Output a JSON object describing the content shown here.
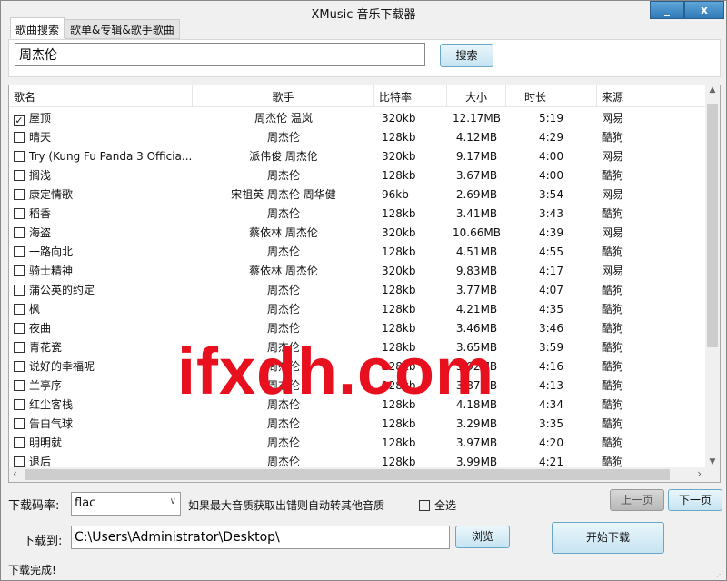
{
  "window": {
    "title": "XMusic 音乐下载器",
    "minimize": "_",
    "close": "x"
  },
  "tabs": [
    {
      "label": "歌曲搜索",
      "active": true
    },
    {
      "label": "歌单&专辑&歌手歌曲",
      "active": false
    }
  ],
  "search": {
    "value": "周杰伦",
    "button": "搜索"
  },
  "table": {
    "columns": [
      "歌名",
      "歌手",
      "比特率",
      "大小",
      "时长",
      "来源"
    ],
    "rows": [
      {
        "checked": true,
        "name": "屋顶",
        "singer": "周杰伦 温岚",
        "bitrate": "320kb",
        "size": "12.17MB",
        "duration": "5:19",
        "source": "网易"
      },
      {
        "checked": false,
        "name": "晴天",
        "singer": "周杰伦",
        "bitrate": "128kb",
        "size": "4.12MB",
        "duration": "4:29",
        "source": "酷狗"
      },
      {
        "checked": false,
        "name": "Try (Kung Fu Panda 3 Officia...",
        "singer": "派伟俊 周杰伦",
        "bitrate": "320kb",
        "size": "9.17MB",
        "duration": "4:00",
        "source": "网易"
      },
      {
        "checked": false,
        "name": "搁浅",
        "singer": "周杰伦",
        "bitrate": "128kb",
        "size": "3.67MB",
        "duration": "4:00",
        "source": "酷狗"
      },
      {
        "checked": false,
        "name": "康定情歌",
        "singer": "宋祖英 周杰伦 周华健",
        "bitrate": "96kb",
        "size": "2.69MB",
        "duration": "3:54",
        "source": "网易"
      },
      {
        "checked": false,
        "name": "稻香",
        "singer": "周杰伦",
        "bitrate": "128kb",
        "size": "3.41MB",
        "duration": "3:43",
        "source": "酷狗"
      },
      {
        "checked": false,
        "name": "海盗",
        "singer": "蔡依林 周杰伦",
        "bitrate": "320kb",
        "size": "10.66MB",
        "duration": "4:39",
        "source": "网易"
      },
      {
        "checked": false,
        "name": "一路向北",
        "singer": "周杰伦",
        "bitrate": "128kb",
        "size": "4.51MB",
        "duration": "4:55",
        "source": "酷狗"
      },
      {
        "checked": false,
        "name": "骑士精神",
        "singer": "蔡依林 周杰伦",
        "bitrate": "320kb",
        "size": "9.83MB",
        "duration": "4:17",
        "source": "网易"
      },
      {
        "checked": false,
        "name": "蒲公英的约定",
        "singer": "周杰伦",
        "bitrate": "128kb",
        "size": "3.77MB",
        "duration": "4:07",
        "source": "酷狗"
      },
      {
        "checked": false,
        "name": "枫",
        "singer": "周杰伦",
        "bitrate": "128kb",
        "size": "4.21MB",
        "duration": "4:35",
        "source": "酷狗"
      },
      {
        "checked": false,
        "name": "夜曲",
        "singer": "周杰伦",
        "bitrate": "128kb",
        "size": "3.46MB",
        "duration": "3:46",
        "source": "酷狗"
      },
      {
        "checked": false,
        "name": "青花瓷",
        "singer": "周杰伦",
        "bitrate": "128kb",
        "size": "3.65MB",
        "duration": "3:59",
        "source": "酷狗"
      },
      {
        "checked": false,
        "name": "说好的幸福呢",
        "singer": "周杰伦",
        "bitrate": "128kb",
        "size": "3.92MB",
        "duration": "4:16",
        "source": "酷狗"
      },
      {
        "checked": false,
        "name": "兰亭序",
        "singer": "周杰伦",
        "bitrate": "128kb",
        "size": "3.87MB",
        "duration": "4:13",
        "source": "酷狗"
      },
      {
        "checked": false,
        "name": "红尘客栈",
        "singer": "周杰伦",
        "bitrate": "128kb",
        "size": "4.18MB",
        "duration": "4:34",
        "source": "酷狗"
      },
      {
        "checked": false,
        "name": "告白气球",
        "singer": "周杰伦",
        "bitrate": "128kb",
        "size": "3.29MB",
        "duration": "3:35",
        "source": "酷狗"
      },
      {
        "checked": false,
        "name": "明明就",
        "singer": "周杰伦",
        "bitrate": "128kb",
        "size": "3.97MB",
        "duration": "4:20",
        "source": "酷狗"
      },
      {
        "checked": false,
        "name": "退后",
        "singer": "周杰伦",
        "bitrate": "128kb",
        "size": "3.99MB",
        "duration": "4:21",
        "source": "酷狗"
      }
    ]
  },
  "bottom": {
    "bitrate_label": "下载码率:",
    "bitrate_value": "flac",
    "hint": "如果最大音质获取出错则自动转其他音质",
    "select_all": "全选",
    "prev": "上一页",
    "next": "下一页",
    "path_label": "下载到:",
    "path": "C:\\Users\\Administrator\\Desktop\\",
    "browse": "浏览",
    "start": "开始下载",
    "status": "下载完成!"
  },
  "watermark": "ifxdh.com"
}
